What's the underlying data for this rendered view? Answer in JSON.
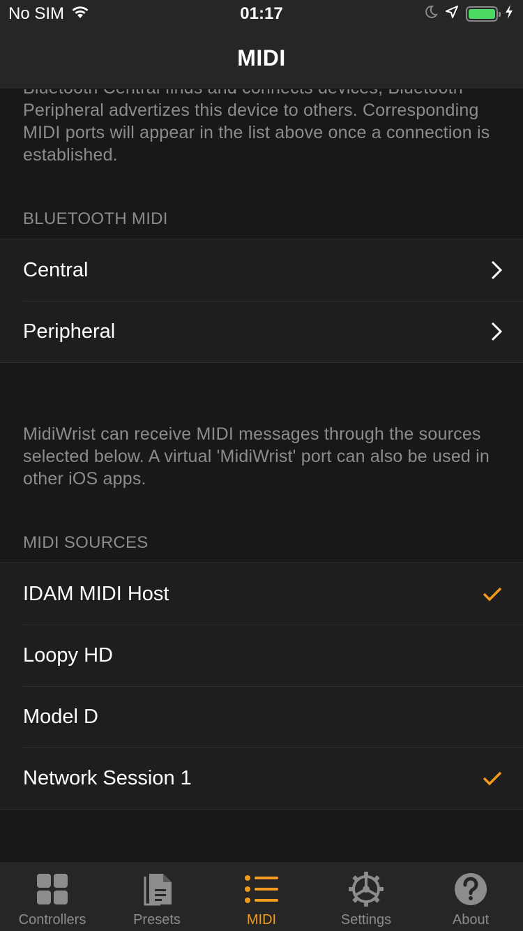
{
  "status": {
    "carrier": "No SIM",
    "time": "01:17"
  },
  "nav": {
    "title": "MIDI"
  },
  "bluetooth_intro": "Bluetooth Central finds and connects devices, Bluetooth Peripheral advertizes this device to others. Corresponding MIDI ports will appear in the list above once a connection is established.",
  "bluetooth_section": {
    "header": "BLUETOOTH MIDI",
    "items": [
      {
        "label": "Central"
      },
      {
        "label": "Peripheral"
      }
    ]
  },
  "sources_intro": "MidiWrist can receive MIDI messages through the sources selected below. A virtual 'MidiWrist' port can also be used in other iOS apps.",
  "sources_section": {
    "header": "MIDI SOURCES",
    "items": [
      {
        "label": "IDAM MIDI Host",
        "checked": true
      },
      {
        "label": "Loopy HD",
        "checked": false
      },
      {
        "label": "Model D",
        "checked": false
      },
      {
        "label": "Network Session 1",
        "checked": true
      }
    ]
  },
  "tabs": [
    {
      "label": "Controllers",
      "icon": "grid-icon"
    },
    {
      "label": "Presets",
      "icon": "document-icon"
    },
    {
      "label": "MIDI",
      "icon": "list-icon",
      "active": true
    },
    {
      "label": "Settings",
      "icon": "gear-icon"
    },
    {
      "label": "About",
      "icon": "question-icon"
    }
  ],
  "colors": {
    "accent": "#f29a1d",
    "background": "#181818",
    "row_background": "#1e1e1e",
    "secondary_text": "#8c8c8c",
    "battery": "#4cd964"
  }
}
